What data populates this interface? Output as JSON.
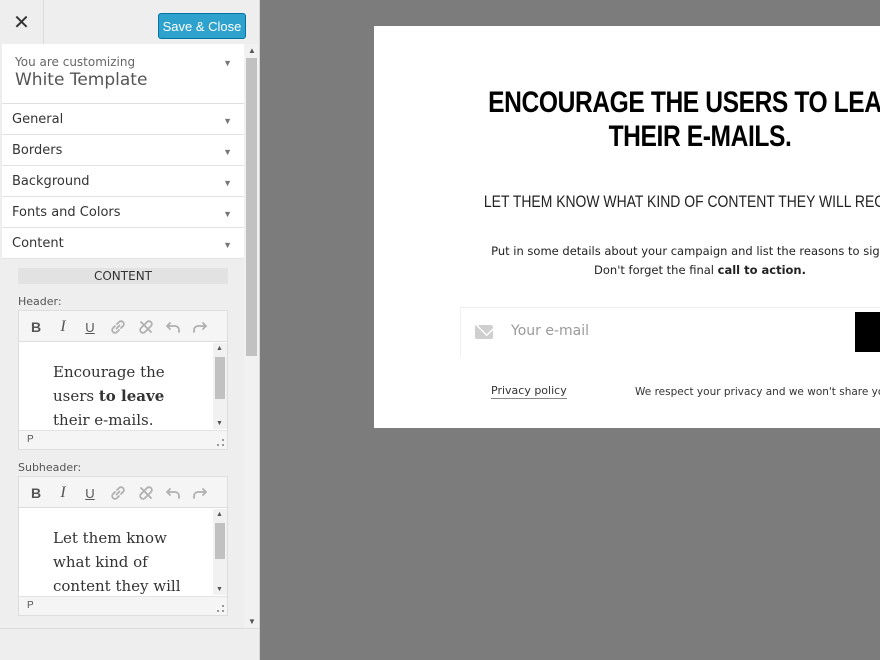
{
  "sidebar": {
    "close_glyph": "✕",
    "save_label": "Save & Close",
    "info_small": "You are customizing",
    "info_title": "White Template",
    "sections": [
      {
        "label": "General"
      },
      {
        "label": "Borders"
      },
      {
        "label": "Background"
      },
      {
        "label": "Fonts and Colors"
      },
      {
        "label": "Content"
      }
    ],
    "content_heading": "CONTENT",
    "header_label": "Header:",
    "subheader_label": "Subheader:",
    "editor_status": "P",
    "header_text_1": "Encourage the users ",
    "header_text_bold": "to leave",
    "header_text_2": " their e-mails.",
    "subheader_text": "Let them know what kind of content they will receive"
  },
  "toolbar_icons": [
    "bold-icon",
    "italic-icon",
    "underline-icon",
    "link-icon",
    "unlink-icon",
    "undo-icon",
    "redo-icon"
  ],
  "toolbar_glyphs": {
    "bold": "B",
    "italic": "I",
    "underline": "U"
  },
  "popup": {
    "headline_line1": "ENCOURAGE THE USERS TO LEAVE",
    "headline_line2": "THEIR E-MAILS.",
    "subheadline": "LET THEM KNOW WHAT KIND OF CONTENT THEY WILL RECEIVE",
    "desc_line1": "Put in some details about your campaign and list the reasons to sign up.",
    "desc_line2_pre": "Don't forget the final ",
    "desc_line2_bold": "call to action.",
    "email_placeholder": "Your e-mail",
    "privacy_link": "Privacy policy",
    "privacy_note": "We respect your privacy and we won't share your information."
  },
  "colors": {
    "accent": "#2ea2cc",
    "overlay": "#7c7c7c",
    "sidebar_bg": "#eeeeee"
  }
}
